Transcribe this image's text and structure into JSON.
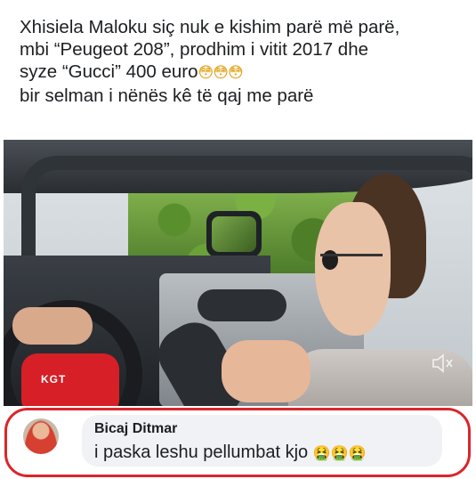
{
  "post": {
    "lines": [
      "Xhisiela Maloku siç nuk e kishim parë më parë,",
      "mbi “Peugeot 208”, prodhim i vitit 2017 dhe",
      "syze “Gucci” 400 euro",
      "bir selman i nënës kê të qaj me parë"
    ],
    "line3_emojis": "😳😳😳"
  },
  "video": {
    "mic_brand": "KGT",
    "mute_icon": "speaker-muted-icon"
  },
  "comment": {
    "author": "Bicaj Ditmar",
    "text": "i paska leshu pellumbat kjo",
    "emojis": "🤮🤮🤮"
  },
  "colors": {
    "highlight_border": "#d9262b",
    "bubble_bg": "#f0f2f5"
  }
}
